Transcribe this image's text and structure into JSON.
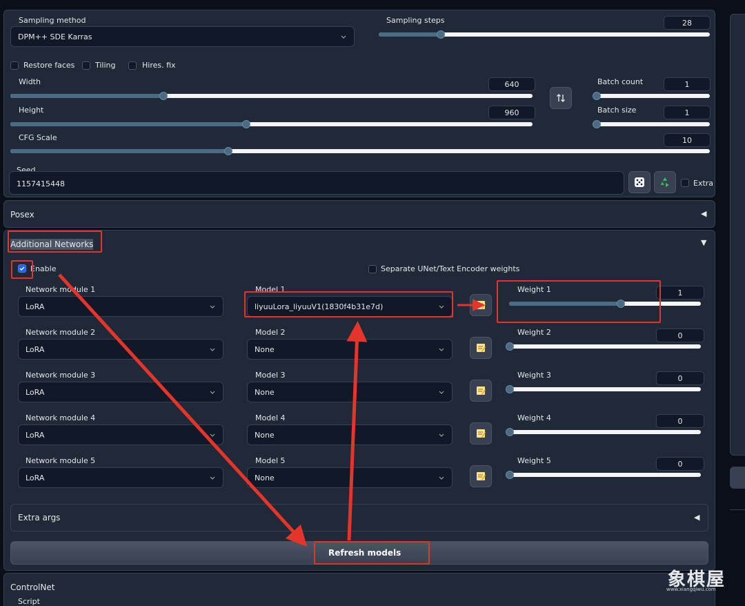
{
  "sampling": {
    "method_label": "Sampling method",
    "method_value": "DPM++ SDE Karras",
    "steps_label": "Sampling steps",
    "steps_value": "28",
    "steps_fraction": 0.18
  },
  "checkboxes": {
    "restore_faces": "Restore faces",
    "tiling": "Tiling",
    "hires_fix": "Hires. fix"
  },
  "size": {
    "width_label": "Width",
    "width_value": "640",
    "height_label": "Height",
    "height_value": "960"
  },
  "batch": {
    "count_label": "Batch count",
    "count_value": "1",
    "size_label": "Batch size",
    "size_value": "1"
  },
  "cfg": {
    "label": "CFG Scale",
    "value": "10"
  },
  "seed": {
    "label": "Seed",
    "value": "1157415448",
    "extra_label": "Extra"
  },
  "posex": {
    "title": "Posex"
  },
  "additional_networks": {
    "title": "Additional Networks",
    "enable_label": "Enable",
    "separate_label": "Separate UNet/Text Encoder weights",
    "rows": [
      {
        "module_label": "Network module 1",
        "module_value": "LoRA",
        "model_label": "Model 1",
        "model_value": "liyuuLora_liyuuV1(1830f4b31e7d)",
        "weight_label": "Weight 1",
        "weight_value": "1"
      },
      {
        "module_label": "Network module 2",
        "module_value": "LoRA",
        "model_label": "Model 2",
        "model_value": "None",
        "weight_label": "Weight 2",
        "weight_value": "0"
      },
      {
        "module_label": "Network module 3",
        "module_value": "LoRA",
        "model_label": "Model 3",
        "model_value": "None",
        "weight_label": "Weight 3",
        "weight_value": "0"
      },
      {
        "module_label": "Network module 4",
        "module_value": "LoRA",
        "model_label": "Model 4",
        "model_value": "None",
        "weight_label": "Weight 4",
        "weight_value": "0"
      },
      {
        "module_label": "Network module 5",
        "module_value": "LoRA",
        "model_label": "Model 5",
        "model_value": "None",
        "weight_label": "Weight 5",
        "weight_value": "0"
      }
    ],
    "extra_args_label": "Extra args",
    "refresh_label": "Refresh models"
  },
  "controlnet": {
    "title": "ControlNet"
  },
  "script": {
    "label": "Script"
  },
  "watermark": {
    "text": "象棋屋",
    "subtext": "www.xiangqiwu.com"
  },
  "colors": {
    "annotation_red": "#e5342a",
    "slider_fill": "#4b6a84",
    "checkbox_blue": "#2563eb"
  },
  "icons": {
    "swap": "swap-dimensions-icon",
    "dice": "dice-icon",
    "recycle": "recycle-icon",
    "edit": "edit-note-icon"
  }
}
